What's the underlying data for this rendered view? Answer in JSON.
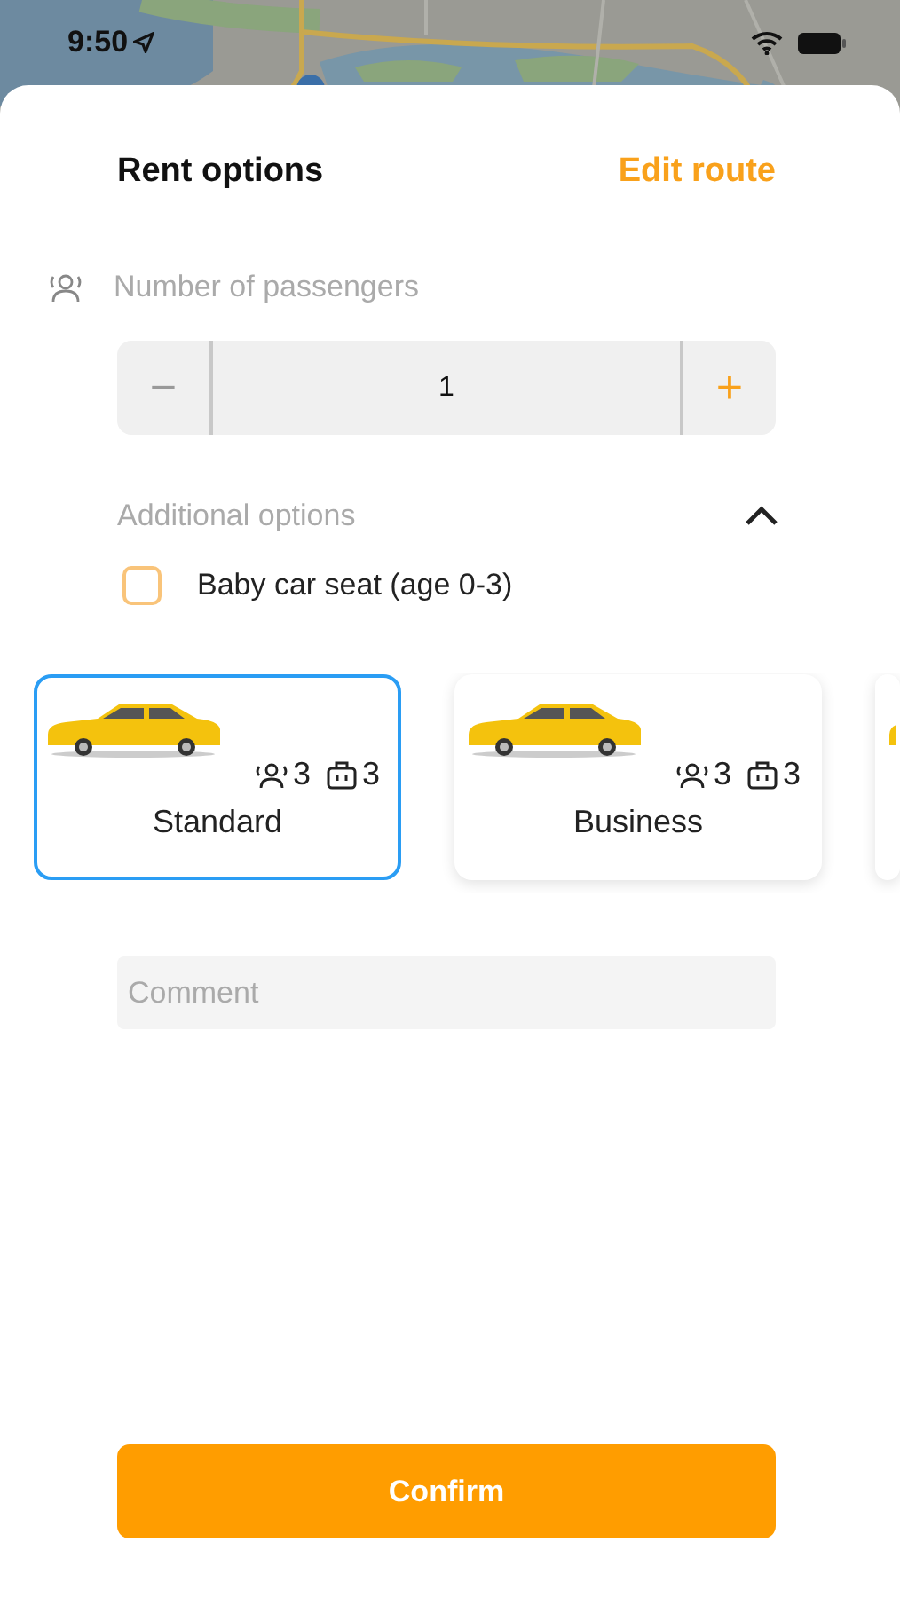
{
  "status_bar": {
    "time": "9:50"
  },
  "header": {
    "title": "Rent options",
    "action": "Edit route"
  },
  "passengers": {
    "label": "Number of passengers",
    "minus": "−",
    "value": "1",
    "plus": "+"
  },
  "additional_options": {
    "label": "Additional options",
    "expanded": true,
    "items": [
      {
        "label": "Baby car seat (age 0-3)",
        "checked": false
      }
    ]
  },
  "classes": [
    {
      "name": "Standard",
      "passengers": "3",
      "luggage": "3",
      "selected": true
    },
    {
      "name": "Business",
      "passengers": "3",
      "luggage": "3",
      "selected": false
    },
    {
      "selected": false
    }
  ],
  "comment": {
    "placeholder": "Comment"
  },
  "confirm": "Confirm"
}
